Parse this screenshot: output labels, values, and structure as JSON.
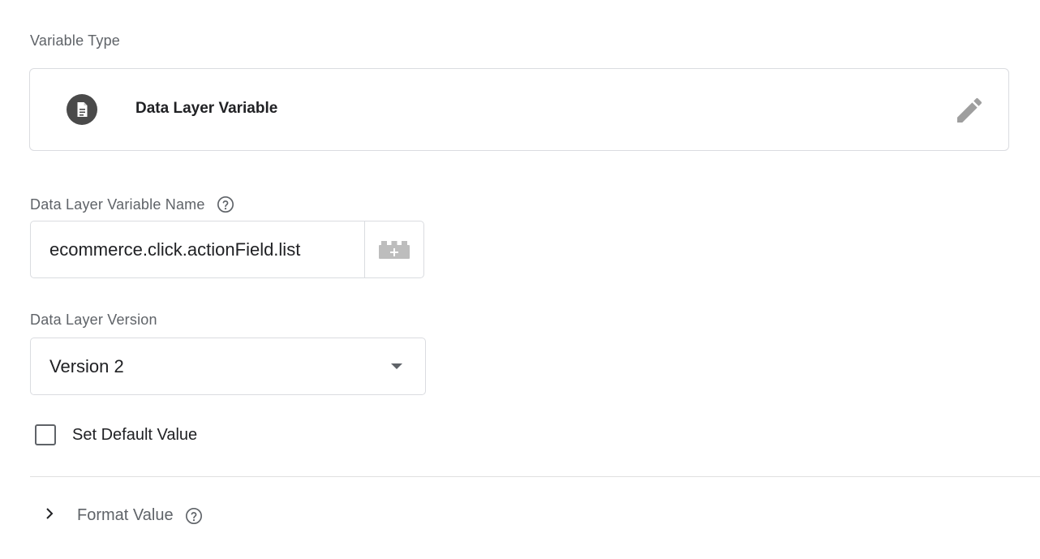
{
  "variable_type": {
    "section_label": "Variable Type",
    "type_name": "Data Layer Variable",
    "icon": "document-icon",
    "edit_icon": "pencil-icon"
  },
  "data_layer_variable_name": {
    "label": "Data Layer Variable Name",
    "value": "ecommerce.click.actionField.list",
    "help_icon": "question-circle-icon",
    "picker_icon": "variable-brick-add-icon"
  },
  "data_layer_version": {
    "label": "Data Layer Version",
    "selected": "Version 2"
  },
  "default_value": {
    "label": "Set Default Value",
    "checked": false
  },
  "format_value": {
    "label": "Format Value",
    "expanded": false,
    "help_icon": "question-circle-icon"
  },
  "colors": {
    "text_primary": "#202124",
    "text_secondary": "#5f6368",
    "border": "#dadce0",
    "icon_dark": "#4a4a4a",
    "icon_muted": "#9e9e9e"
  }
}
